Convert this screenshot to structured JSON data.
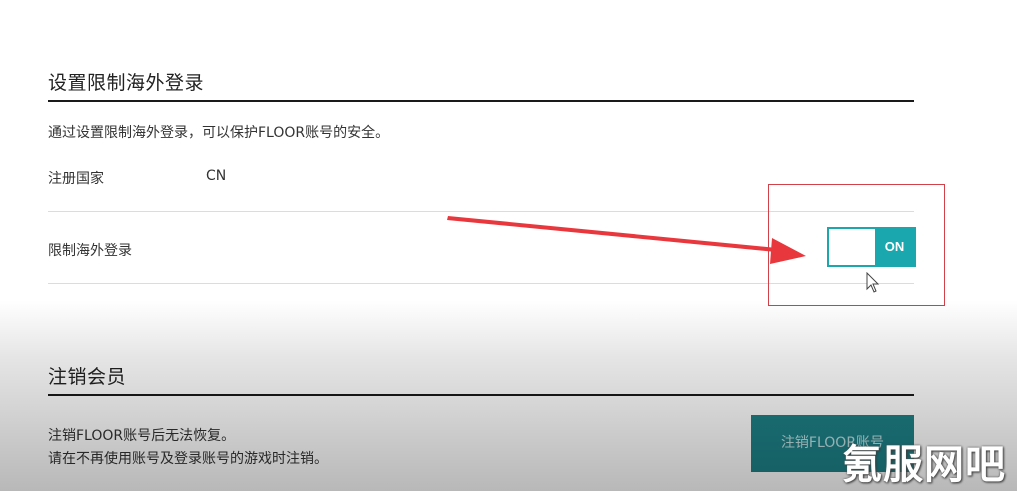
{
  "restrict_overseas": {
    "title": "设置限制海外登录",
    "description": "通过设置限制海外登录，可以保护FLOOR账号的安全。",
    "country_label": "注册国家",
    "country_value": "CN",
    "restrict_label": "限制海外登录",
    "toggle_state_label": "ON",
    "toggle_color": "#1aa7ad"
  },
  "delete_account": {
    "title": "注销会员",
    "line1": "注销FLOOR账号后无法恢复。",
    "line2": "请在不再使用账号及登录账号的游戏时注销。",
    "button_label": "注销FLOOR账号",
    "button_color": "#1d8187"
  },
  "watermark": "氪服网吧",
  "annotation_color": "#e8383d"
}
